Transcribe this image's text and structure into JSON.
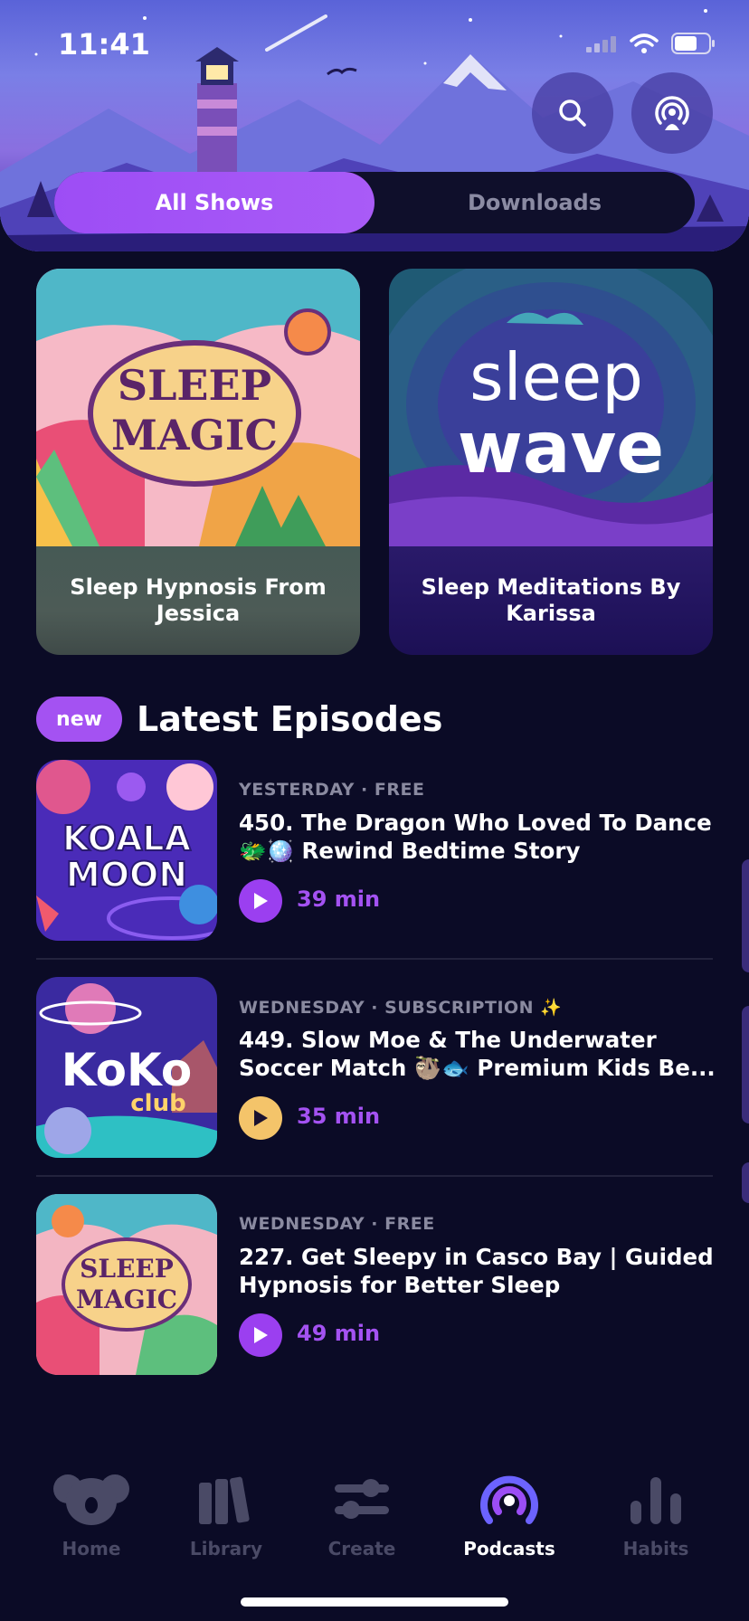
{
  "status": {
    "time": "11:41"
  },
  "segmented": {
    "all_shows": "All Shows",
    "downloads": "Downloads"
  },
  "shows": [
    {
      "art_title_line1": "SLEEP",
      "art_title_line2": "MAGIC",
      "caption": "Sleep Hypnosis From Jessica"
    },
    {
      "art_title_line1": "sleep",
      "art_title_line2": "wave",
      "caption": "Sleep Meditations By Karissa"
    }
  ],
  "latest": {
    "badge": "new",
    "title": "Latest Episodes",
    "episodes": [
      {
        "thumb_line1": "KOALA",
        "thumb_line2": "MOON",
        "meta": "YESTERDAY · FREE",
        "title_line1": "450. The Dragon Who Loved To Dance",
        "title_line2": "🐲🪩 Rewind Bedtime Story",
        "duration": "39 min"
      },
      {
        "thumb_line1": "KoKo",
        "thumb_line2": "club",
        "meta": "WEDNESDAY · SUBSCRIPTION ✨",
        "title_line1": "449. Slow Moe & The Underwater",
        "title_line2": "Soccer Match 🦥🐟 Premium Kids Be...",
        "duration": "35 min"
      },
      {
        "thumb_line1": "SLEEP",
        "thumb_line2": "MAGIC",
        "meta": "WEDNESDAY · FREE",
        "title_line1": "227. Get Sleepy in Casco Bay | Guided",
        "title_line2": "Hypnosis for Better Sleep",
        "duration": "49 min"
      }
    ]
  },
  "tabs": [
    {
      "label": "Home",
      "icon": "koala-icon"
    },
    {
      "label": "Library",
      "icon": "books-icon"
    },
    {
      "label": "Create",
      "icon": "sliders-icon"
    },
    {
      "label": "Podcasts",
      "icon": "podcast-icon"
    },
    {
      "label": "Habits",
      "icon": "bar-chart-icon"
    }
  ],
  "colors": {
    "accent": "#a452f2",
    "background": "#0b0b26",
    "gold": "#f4c46a"
  }
}
